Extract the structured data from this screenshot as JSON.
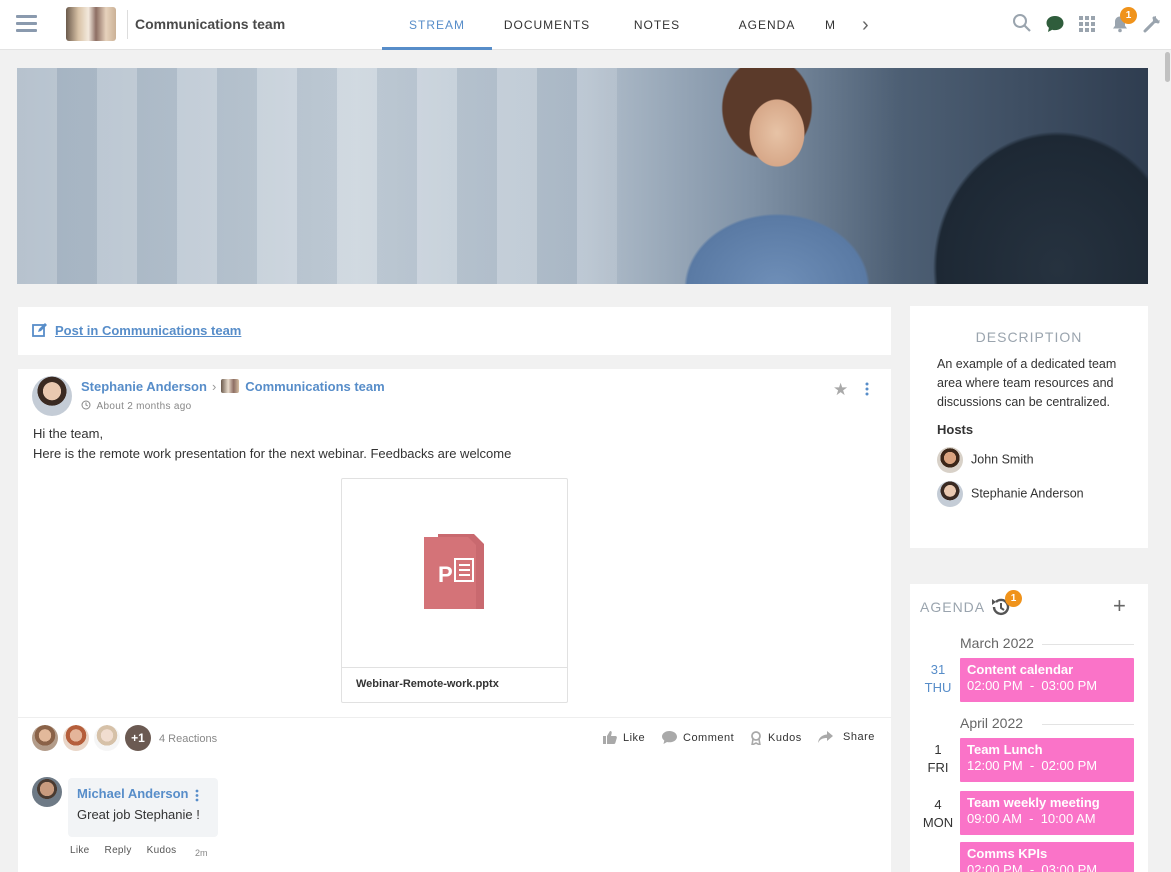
{
  "header": {
    "space_name": "Communications team",
    "tabs": [
      "STREAM",
      "DOCUMENTS",
      "NOTES",
      "AGENDA",
      "M"
    ],
    "active_tab": "STREAM",
    "notification_count": "1"
  },
  "composer": {
    "link": "Post in Communications team"
  },
  "activity": {
    "author": "Stephanie Anderson",
    "space": "Communications team",
    "time": "About 2 months ago",
    "text_line1": "Hi the team,",
    "text_line2": "Here is the remote work presentation for the next webinar. Feedbacks are welcome",
    "attachment": {
      "name": "Webinar-Remote-work.pptx",
      "icon": "powerpoint-file-icon"
    },
    "reactions_more": "+1",
    "reactions_count": "4 Reactions",
    "actions": {
      "like": "Like",
      "comment": "Comment",
      "kudos": "Kudos",
      "share": "Share"
    },
    "comment": {
      "author": "Michael Anderson",
      "text": "Great job Stephanie !",
      "actions": [
        "Like",
        "Reply",
        "Kudos"
      ],
      "time": "2m"
    }
  },
  "description": {
    "title": "DESCRIPTION",
    "text": "An example of a dedicated team area where team resources and discussions can be centralized.",
    "hosts_label": "Hosts",
    "hosts": [
      "John Smith",
      "Stephanie Anderson"
    ]
  },
  "agenda": {
    "title": "AGENDA",
    "badge": "1",
    "months": [
      "March 2022",
      "April 2022"
    ],
    "days": [
      {
        "num": "31",
        "dow": "THU"
      },
      {
        "num": "1",
        "dow": "FRI"
      },
      {
        "num": "4",
        "dow": "MON"
      }
    ],
    "events": [
      {
        "title": "Content calendar",
        "time": "02:00 PM  -  03:00 PM"
      },
      {
        "title": "Team Lunch",
        "time": "12:00 PM  -  02:00 PM"
      },
      {
        "title": "Team weekly meeting",
        "time": "09:00 AM  -  10:00 AM"
      },
      {
        "title": "Comms KPIs",
        "time": "02:00 PM  -  03:00 PM"
      }
    ],
    "event_color": "#fa73c8"
  },
  "colors": {
    "accent": "#578dc9",
    "badge": "#f0931b"
  }
}
